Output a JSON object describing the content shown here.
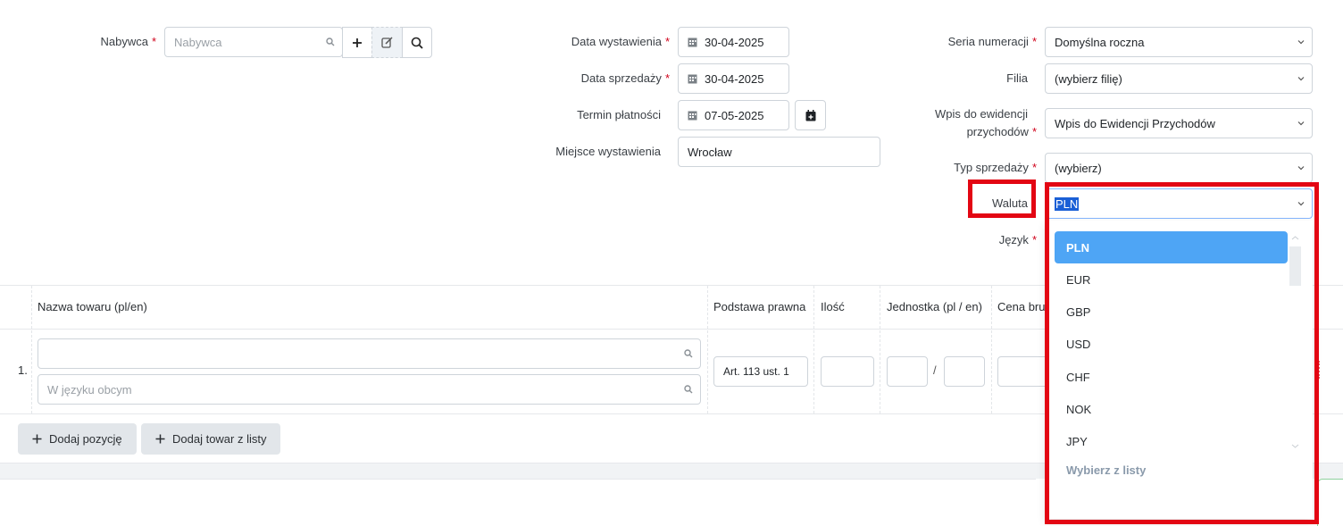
{
  "form": {
    "buyer": {
      "label": "Nabywca",
      "required_mark": "*",
      "placeholder": "Nabywca"
    },
    "issue_date": {
      "label": "Data wystawienia",
      "required_mark": "*",
      "value": "30-04-2025"
    },
    "sale_date": {
      "label": "Data sprzedaży",
      "required_mark": "*",
      "value": "30-04-2025"
    },
    "payment_due": {
      "label": "Termin płatności",
      "value": "07-05-2025"
    },
    "place": {
      "label": "Miejsce wystawienia",
      "value": "Wrocław"
    },
    "numbering": {
      "label": "Seria numeracji",
      "required_mark": "*",
      "value": "Domyślna roczna"
    },
    "branch": {
      "label": "Filia",
      "value": "(wybierz filię)"
    },
    "registry": {
      "label_line1": "Wpis do ewidencji",
      "label_line2": "przychodów",
      "required_mark": "*",
      "value": "Wpis do Ewidencji Przychodów"
    },
    "sale_type": {
      "label": "Typ sprzedaży",
      "required_mark": "*",
      "value": "(wybierz)"
    },
    "currency": {
      "label": "Waluta",
      "value": "PLN"
    },
    "language": {
      "label": "Język",
      "required_mark": "*"
    }
  },
  "currency_dropdown": {
    "options": [
      "PLN",
      "EUR",
      "GBP",
      "USD",
      "CHF",
      "NOK",
      "JPY"
    ],
    "selected": "PLN",
    "footer": "Wybierz z listy"
  },
  "table": {
    "headers": {
      "name": "Nazwa towaru (pl/en)",
      "legal_basis": "Podstawa prawna",
      "quantity": "Ilość",
      "unit": "Jednostka (pl / en)",
      "gross_price": "Cena bru"
    },
    "rows": [
      {
        "number": "1.",
        "foreign_placeholder": "W języku obcym",
        "legal_basis": "Art. 113 ust. 1",
        "unit_separator": "/"
      }
    ]
  },
  "actions": {
    "add_position": "Dodaj pozycję",
    "add_from_list": "Dodaj towar z listy"
  },
  "colors": {
    "accent": "#4ea5f5",
    "highlight_red": "#e30613",
    "selection_blue": "#1a5fd6"
  }
}
